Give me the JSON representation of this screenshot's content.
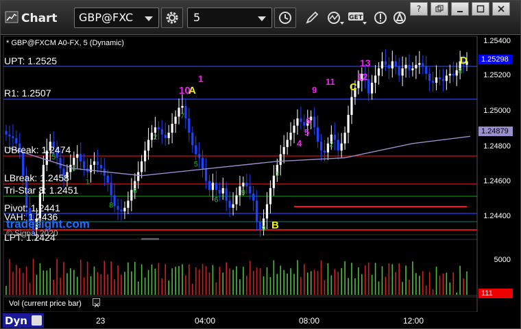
{
  "toolbar": {
    "title": "Chart",
    "symbol": "GBP@FXC",
    "interval": "5",
    "icons": [
      "gear-icon",
      "clock-icon",
      "pencil-icon",
      "indicator-icon",
      "get-icon",
      "alert-icon",
      "question-icon"
    ],
    "window_controls": [
      "?",
      "restore",
      "minimize",
      "maximize",
      "close"
    ]
  },
  "chart_header": "* GBP@FXCM A0-FX, 5 (Dynamic)",
  "levels": {
    "upt": "UPT: 1.2525",
    "r1": "R1: 1.2507",
    "ubreak": "UBreak: 1.2474",
    "lbreak": "LBreak: 1.2458",
    "tri_star": "Tri-Star 3: 1.2451",
    "pivot": "Pivot: 1.2441",
    "vah": "VAH: 1.2436",
    "lpt": "LPT: 1.2424"
  },
  "watermark": {
    "brand": "tradesight.com",
    "copyright": "© Signal 2020"
  },
  "pattern_labels": {
    "a": "A",
    "b": "B",
    "c": "C",
    "d": "D",
    "n10": "10",
    "n1": "1",
    "n13": "13",
    "n12": "12",
    "n11": "11",
    "n9": "9",
    "n6": "6",
    "n5": "5",
    "n4": "4"
  },
  "price_axis": {
    "ticks": [
      "1.25400",
      "1.25200",
      "1.25000",
      "1.24800",
      "1.24600",
      "1.24400"
    ],
    "last_price": "1.25298",
    "ma_price": "1.24879",
    "last_price_color": "#0000ff",
    "ma_price_color": "#9b8fd0"
  },
  "volume_panel": {
    "label": "Vol (current price bar)",
    "tick": "5000",
    "last_value": "111",
    "last_value_color": "#ff0000"
  },
  "time_axis": {
    "corner": "Dyn",
    "ticks": [
      "23",
      "04:00",
      "08:00",
      "12:00"
    ]
  },
  "chart_data": {
    "type": "candlestick",
    "symbol": "GBP@FXCM A0-FX",
    "interval": "5",
    "ylim": [
      1.2433,
      1.2544
    ],
    "closes": [
      1.2489,
      1.2488,
      1.2487,
      1.2484,
      1.2479,
      1.2466,
      1.2448,
      1.244,
      1.2436,
      1.2442,
      1.2456,
      1.2472,
      1.248,
      1.2485,
      1.2482,
      1.2476,
      1.247,
      1.2465,
      1.2468,
      1.2472,
      1.2476,
      1.2478,
      1.2474,
      1.247,
      1.2468,
      1.2472,
      1.2474,
      1.2472,
      1.247,
      1.2466,
      1.2462,
      1.2455,
      1.2449,
      1.2447,
      1.2446,
      1.2448,
      1.2452,
      1.2458,
      1.2463,
      1.2468,
      1.2474,
      1.248,
      1.2486,
      1.249,
      1.2493,
      1.2492,
      1.2489,
      1.2487,
      1.249,
      1.2495,
      1.2499,
      1.2504,
      1.2505,
      1.2498,
      1.249,
      1.2483,
      1.2478,
      1.2476,
      1.247,
      1.2463,
      1.2458,
      1.2462,
      1.2458,
      1.2456,
      1.2459,
      1.2452,
      1.2448,
      1.245,
      1.2455,
      1.246,
      1.2462,
      1.246,
      1.2456,
      1.2452,
      1.244,
      1.2436,
      1.2442,
      1.245,
      1.2459,
      1.2466,
      1.2472,
      1.2478,
      1.2482,
      1.2486,
      1.249,
      1.2494,
      1.2498,
      1.2496,
      1.2494,
      1.2497,
      1.2499,
      1.2493,
      1.2485,
      1.248,
      1.2479,
      1.2484,
      1.2489,
      1.2486,
      1.248,
      1.2484,
      1.249,
      1.25,
      1.251,
      1.2515,
      1.2519,
      1.2523,
      1.252,
      1.2512,
      1.2518,
      1.2522,
      1.2526,
      1.253,
      1.2528,
      1.2526,
      1.253,
      1.2527,
      1.2522,
      1.2526,
      1.2528,
      1.2525,
      1.2526,
      1.2528,
      1.2529,
      1.2527,
      1.2523,
      1.2519,
      1.2518,
      1.2521,
      1.252,
      1.2519,
      1.2522,
      1.2523,
      1.2522,
      1.2525,
      1.253,
      1.2528,
      1.253
    ],
    "moving_average": [
      [
        0,
        1.2482
      ],
      [
        20,
        1.247
      ],
      [
        40,
        1.2466
      ],
      [
        60,
        1.247
      ],
      [
        80,
        1.2474
      ],
      [
        100,
        1.2476
      ],
      [
        110,
        1.248
      ],
      [
        120,
        1.2484
      ],
      [
        137,
        1.2488
      ]
    ],
    "volume": {
      "max": 5000
    }
  }
}
